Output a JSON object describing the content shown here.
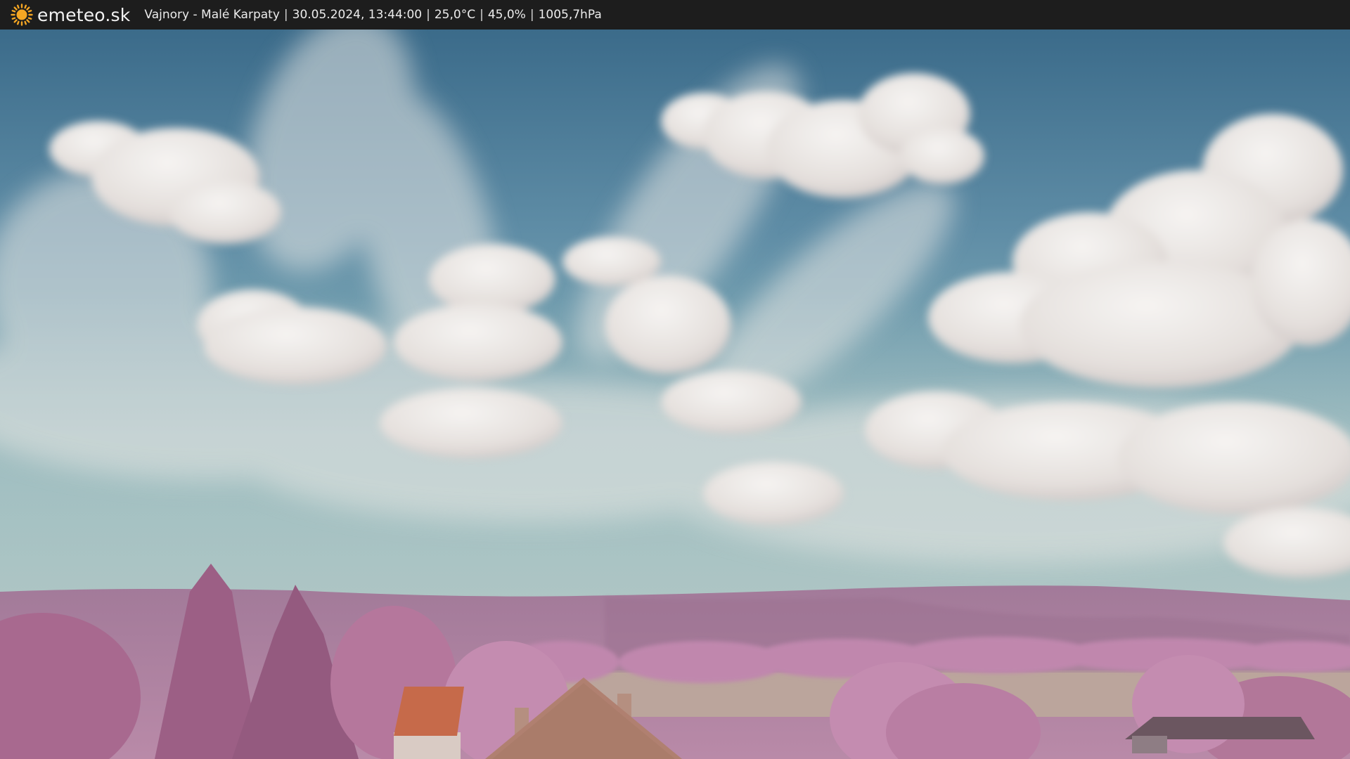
{
  "brand": {
    "name": "emeteo.sk",
    "icon": "sun-icon",
    "icon_color": "#f5a623"
  },
  "observation": {
    "location": "Vajnory - Malé Karpaty",
    "datetime": "30.05.2024, 13:44:00",
    "temperature": "25,0°C",
    "humidity": "45,0%",
    "pressure": "1005,7hPa",
    "separator": "|"
  },
  "colors": {
    "bar_background": "#1d1d1d",
    "sky_top": "#3d6f8e",
    "sky_horizon": "#5fa8b0",
    "vegetation": "#b5789e",
    "roof": "#c66a4a"
  }
}
